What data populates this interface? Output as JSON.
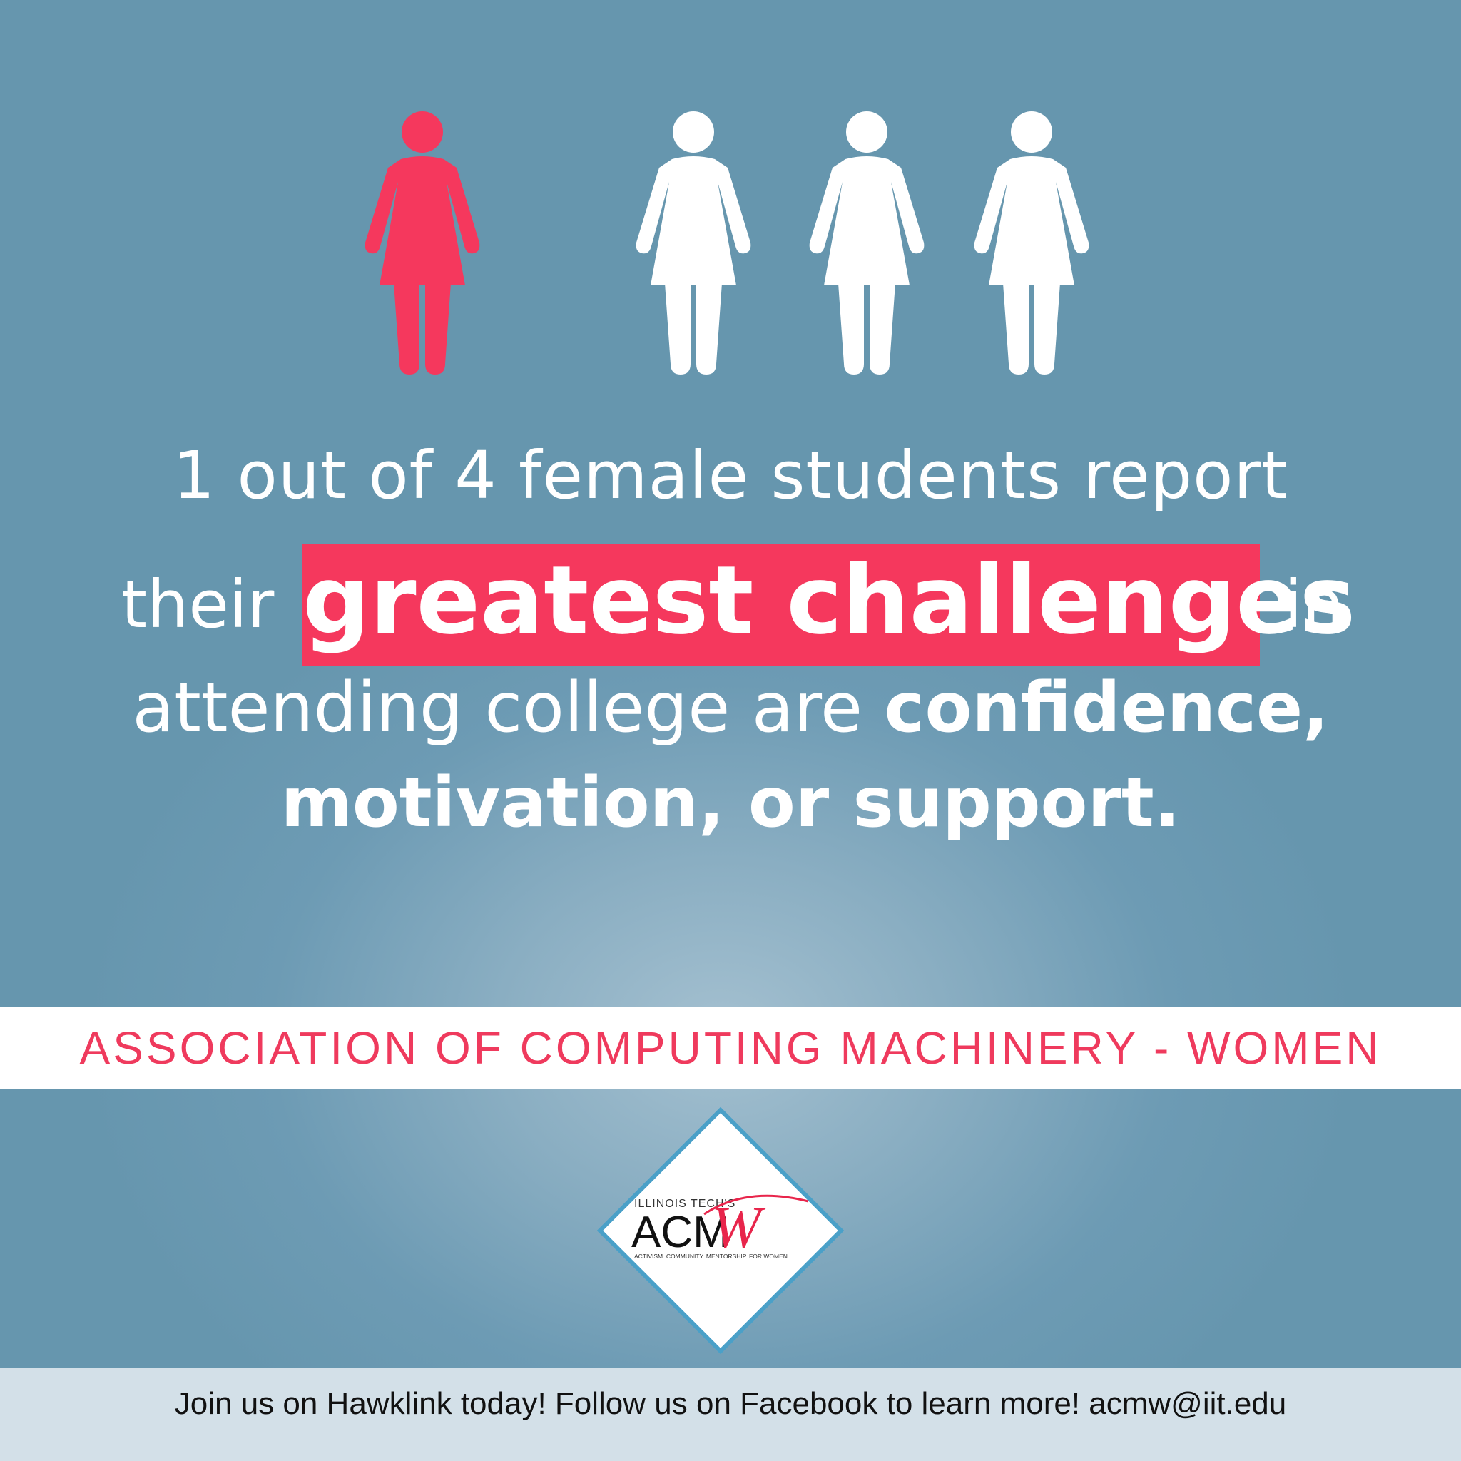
{
  "infographic": {
    "figures": {
      "total": 4,
      "highlighted": 1,
      "highlight_color": "#f5385d",
      "base_color": "#ffffff"
    },
    "headline": {
      "line1": "1 out of 4 female students report",
      "line2_before": "their",
      "line2_highlight": "greatest challenges",
      "line2_after": "in",
      "line3_plain": "attending college are",
      "line3_bold": "confidence,",
      "line4": "motivation, or support."
    },
    "band": {
      "text": "ASSOCIATION OF COMPUTING MACHINERY - WOMEN"
    },
    "logo": {
      "top_text": "ILLINOIS TECH'S",
      "main_text": "ACM",
      "script_letter": "W",
      "tagline": "ACTIVISM. COMMUNITY. MENTORSHIP. FOR WOMEN"
    },
    "footer": {
      "text": "Join us on Hawklink today! Follow us on Facebook to learn more! acmw@iit.edu"
    },
    "colors": {
      "background": "#6898b0",
      "accent": "#f5385d",
      "band_text": "#ef3a5d",
      "logo_border": "#4aa0c8"
    }
  }
}
